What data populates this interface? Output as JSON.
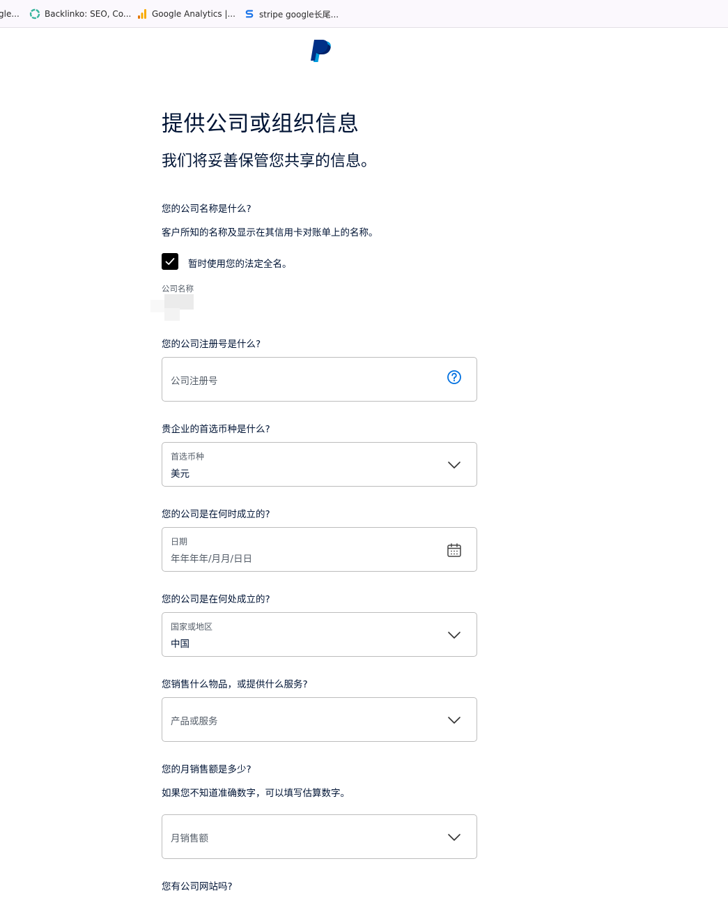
{
  "bookmarks": [
    {
      "label": "gle..."
    },
    {
      "label": "Backlinko: SEO, Co..."
    },
    {
      "label": "Google Analytics |..."
    },
    {
      "label": "stripe google长尾..."
    }
  ],
  "header": {
    "title": "提供公司或组织信息",
    "subtitle": "我们将妥善保管您共享的信息。"
  },
  "company_name_section": {
    "question": "您的公司名称是什么?",
    "helper": "客户所知的名称及显示在其信用卡对账单上的名称。",
    "checkbox_label": "暂时使用您的法定全名。",
    "checkbox_checked": true,
    "field_label": "公司名称"
  },
  "registration": {
    "question": "您的公司注册号是什么?",
    "placeholder": "公司注册号"
  },
  "currency": {
    "question": "贵企业的首选币种是什么?",
    "label": "首选币种",
    "value": "美元"
  },
  "founded_date": {
    "question": "您的公司是在何时成立的?",
    "label": "日期",
    "value": "年年年年/月月/日日"
  },
  "founded_place": {
    "question": "您的公司是在何处成立的?",
    "label": "国家或地区",
    "value": "中国"
  },
  "products": {
    "question": "您销售什么物品，或提供什么服务?",
    "placeholder": "产品或服务"
  },
  "monthly_sales": {
    "question": "您的月销售额是多少?",
    "helper": "如果您不知道准确数字，可以填写估算数字。",
    "placeholder": "月销售额"
  },
  "website": {
    "question": "您有公司网站吗?"
  },
  "colors": {
    "brand_dark": "#003087",
    "brand_light": "#009cde",
    "help_icon": "#0070e0",
    "text": "#001435"
  }
}
